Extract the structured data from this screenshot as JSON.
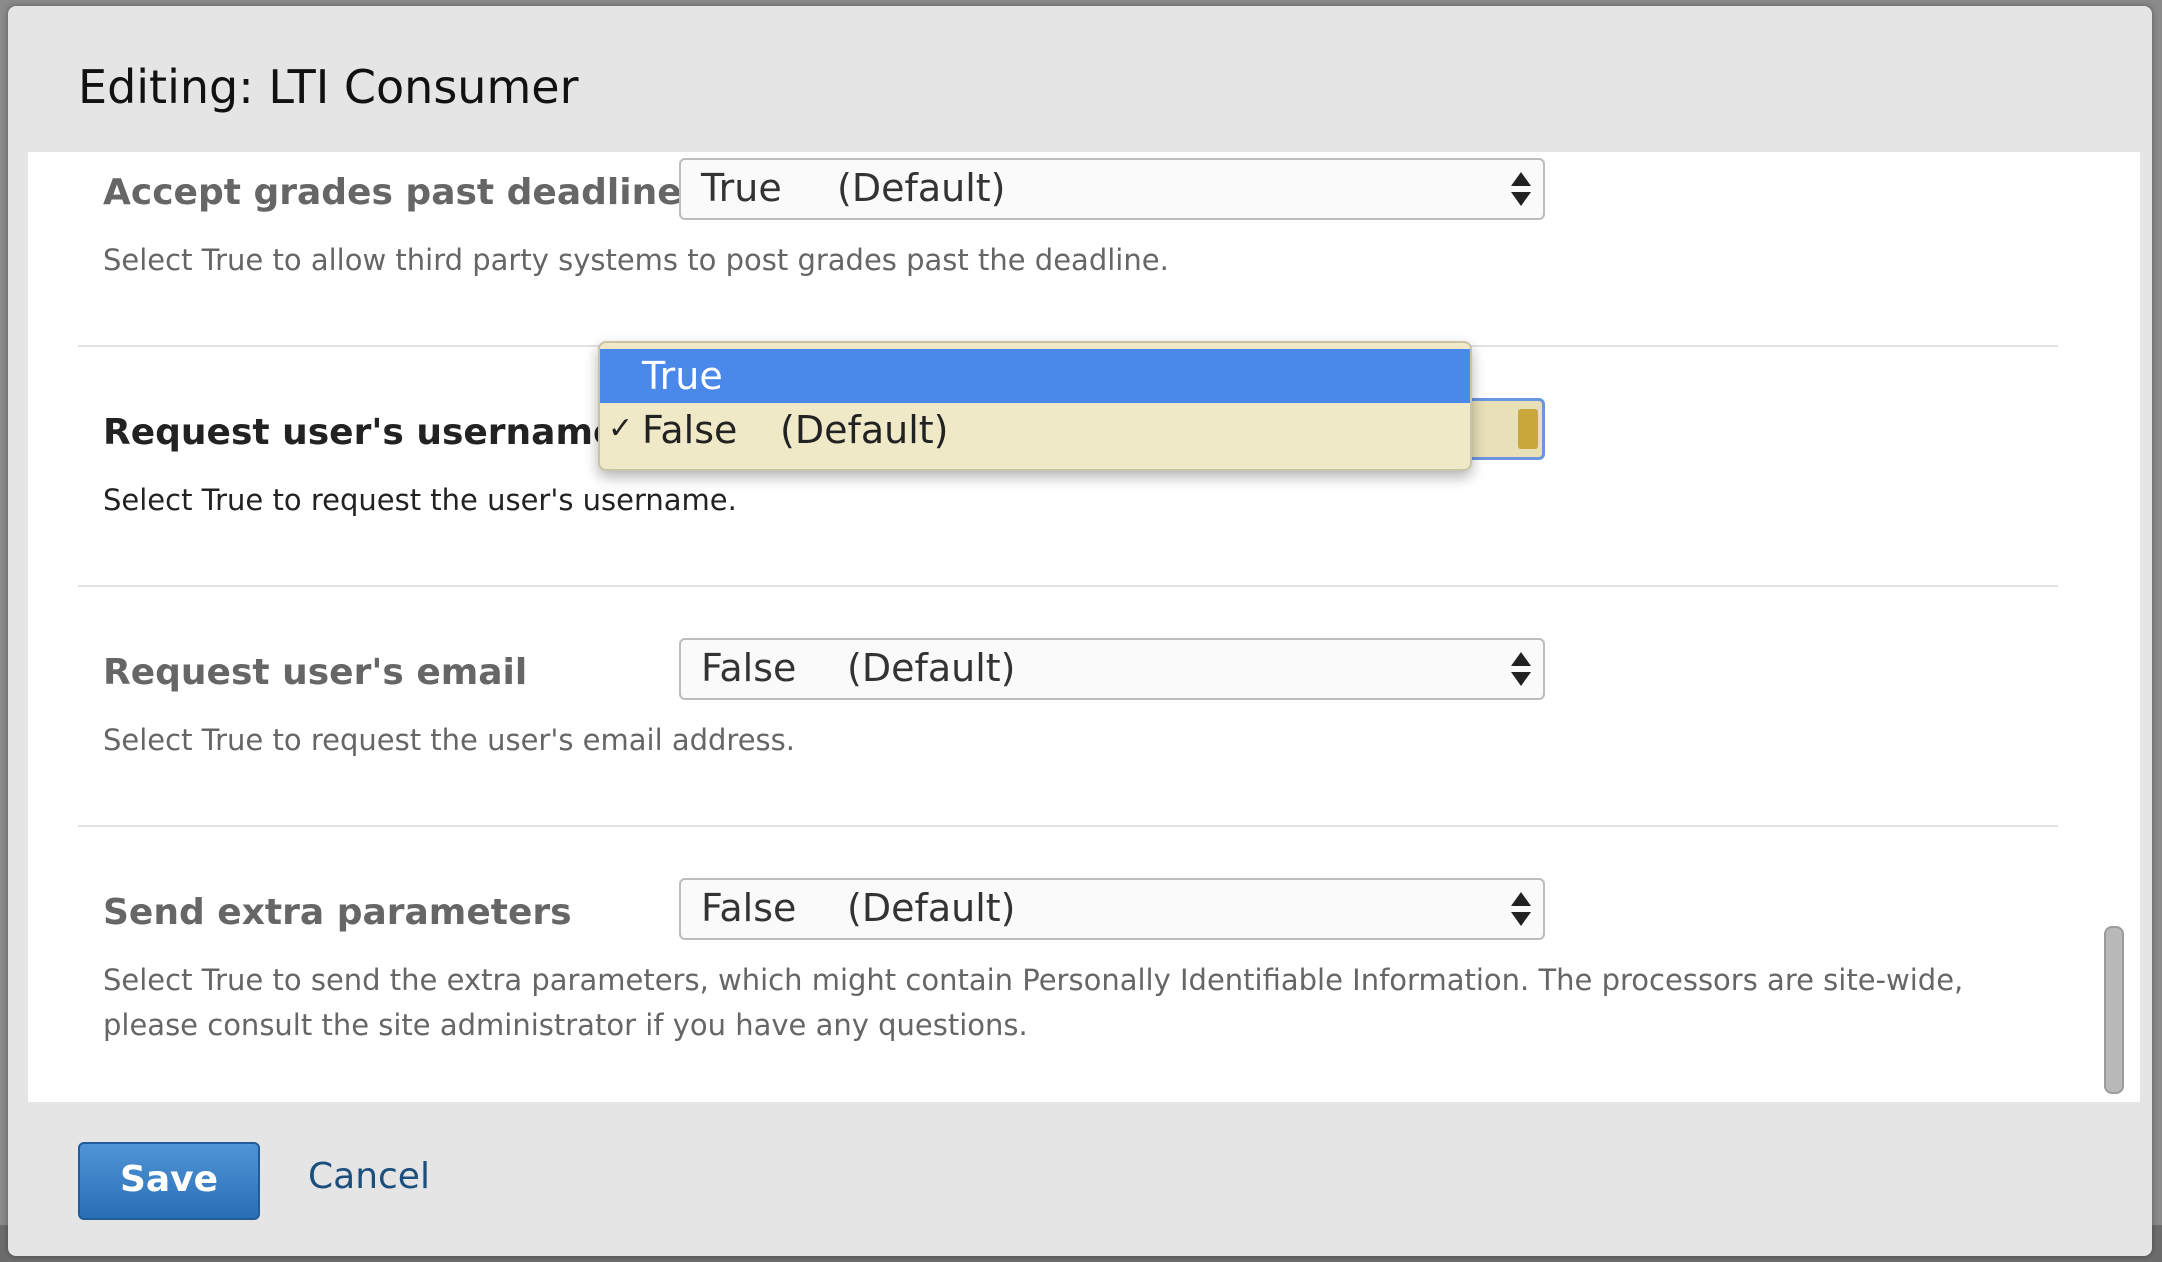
{
  "modal": {
    "title": "Editing: LTI Consumer"
  },
  "fields": [
    {
      "label": "Accept grades past deadline",
      "value": "True",
      "default_marker": "(Default)",
      "help": "Select True to allow third party systems to post grades past the deadline."
    },
    {
      "label": "Request user's username",
      "value": "False",
      "default_marker": "(Default)",
      "help": "Select True to request the user's username."
    },
    {
      "label": "Request user's email",
      "value": "False",
      "default_marker": "(Default)",
      "help": "Select True to request the user's email address."
    },
    {
      "label": "Send extra parameters",
      "value": "False",
      "default_marker": "(Default)",
      "help": "Select True to send the extra parameters, which might contain Personally Identifiable Information. The processors are site-wide, please consult the site administrator if you have any questions."
    }
  ],
  "dropdown": {
    "options": [
      {
        "label": "True",
        "default_marker": "",
        "checked": false
      },
      {
        "label": "False",
        "default_marker": "(Default)",
        "checked": true,
        "check_glyph": "✓"
      }
    ],
    "highlight_color": "#4a88ea",
    "selected_bg_color": "#efe9c8"
  },
  "footer": {
    "save_label": "Save",
    "cancel_label": "Cancel"
  },
  "colors": {
    "modal_bg": "#e5e5e5",
    "save_button": "#2a6fb5",
    "cancel_link": "#1d4f7d"
  }
}
